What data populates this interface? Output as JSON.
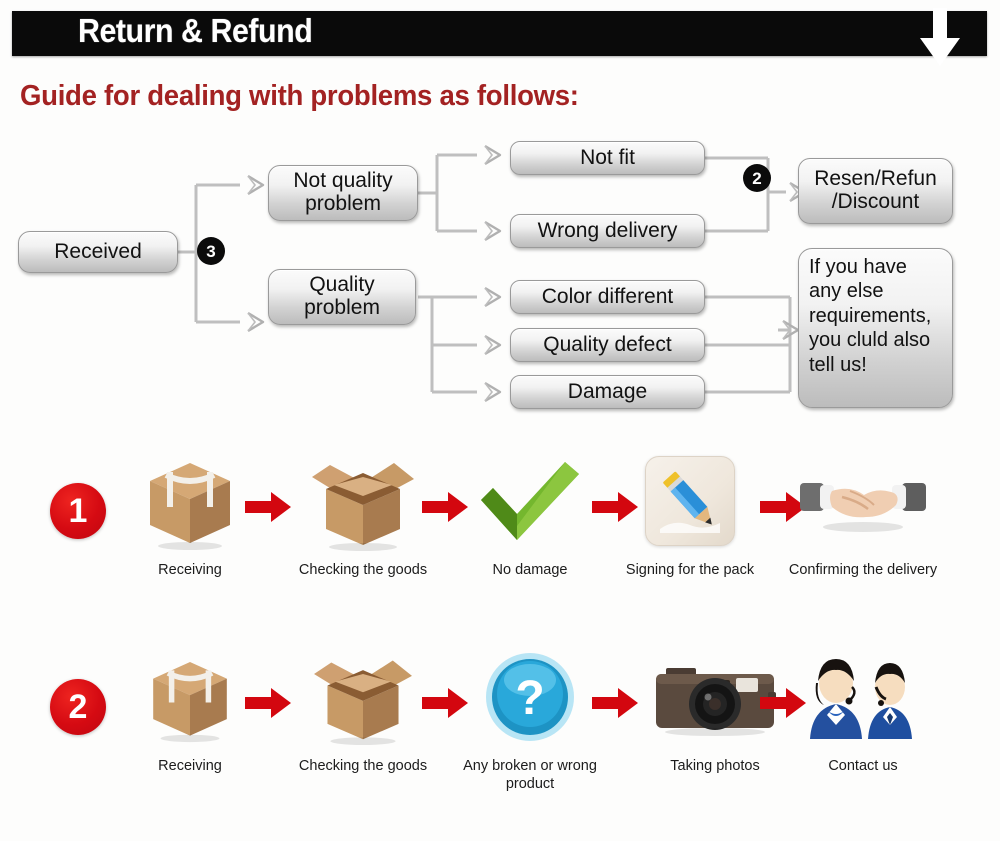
{
  "header": {
    "title": "Return & Refund",
    "arrow_icon": "down-arrow-icon"
  },
  "guide": {
    "heading": "Guide for dealing with problems as follows:"
  },
  "colors": {
    "header_bg": "#0a0a0a",
    "heading_red": "#a32222",
    "arrow_red": "#d3070f",
    "badge_red": "#d50a12",
    "node_border": "#9a9a9a",
    "connector": "#b8b8b8"
  },
  "flowchart": {
    "type": "flow-diagram",
    "markers": [
      {
        "label": "3",
        "name": "step-marker-3"
      },
      {
        "label": "2",
        "name": "step-marker-2"
      }
    ],
    "nodes": {
      "received": "Received",
      "not_quality_problem": "Not quality problem",
      "quality_problem": "Quality problem",
      "not_fit": "Not fit",
      "wrong_delivery": "Wrong delivery",
      "color_different": "Color different",
      "quality_defect": "Quality defect",
      "damage": "Damage",
      "resend_refund": "Resen/Refun /Discount",
      "any_else": "If you have any else requirements, you cluld also tell us!"
    },
    "edges": [
      {
        "from": "received",
        "to": "not_quality_problem"
      },
      {
        "from": "received",
        "to": "quality_problem"
      },
      {
        "from": "not_quality_problem",
        "to": "not_fit"
      },
      {
        "from": "not_quality_problem",
        "to": "wrong_delivery"
      },
      {
        "from": "quality_problem",
        "to": "color_different"
      },
      {
        "from": "quality_problem",
        "to": "quality_defect"
      },
      {
        "from": "quality_problem",
        "to": "damage"
      },
      {
        "from": "not_fit",
        "to": "resend_refund"
      },
      {
        "from": "wrong_delivery",
        "to": "resend_refund"
      },
      {
        "from": "color_different",
        "to": "any_else"
      },
      {
        "from": "quality_defect",
        "to": "any_else"
      },
      {
        "from": "damage",
        "to": "any_else"
      }
    ]
  },
  "process_rows": [
    {
      "badge": "1",
      "badge_name": "process-badge-1",
      "steps": [
        {
          "caption": "Receiving",
          "icon": "closed-box-icon"
        },
        {
          "caption": "Checking the goods",
          "icon": "open-box-icon"
        },
        {
          "caption": "No damage",
          "icon": "green-check-icon"
        },
        {
          "caption": "Signing for the pack",
          "icon": "pencil-signing-icon"
        },
        {
          "caption": "Confirming the delivery",
          "icon": "handshake-icon"
        }
      ]
    },
    {
      "badge": "2",
      "badge_name": "process-badge-2",
      "steps": [
        {
          "caption": "Receiving",
          "icon": "closed-box-icon"
        },
        {
          "caption": "Checking the goods",
          "icon": "open-box-icon"
        },
        {
          "caption": "Any broken or wrong product",
          "icon": "question-mark-icon"
        },
        {
          "caption": "Taking photos",
          "icon": "camera-icon"
        },
        {
          "caption": "Contact us",
          "icon": "support-agents-icon"
        }
      ]
    }
  ]
}
